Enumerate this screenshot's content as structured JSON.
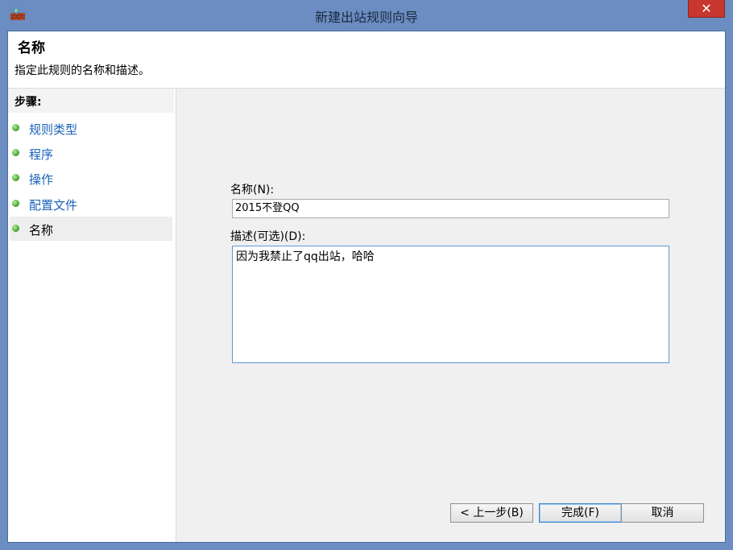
{
  "window": {
    "title": "新建出站规则向导",
    "close_label": "✕"
  },
  "header": {
    "title": "名称",
    "description": "指定此规则的名称和描述。"
  },
  "sidebar": {
    "title": "步骤:",
    "steps": [
      {
        "label": "规则类型"
      },
      {
        "label": "程序"
      },
      {
        "label": "操作"
      },
      {
        "label": "配置文件"
      },
      {
        "label": "名称"
      }
    ]
  },
  "form": {
    "name_label": "名称(N):",
    "name_value": "2015不登QQ",
    "desc_label": "描述(可选)(D):",
    "desc_value": "因为我禁止了qq出站，哈哈"
  },
  "buttons": {
    "back": "< 上一步(B)",
    "finish": "完成(F)",
    "cancel": "取消"
  },
  "icons": {
    "app": "firewall-icon",
    "step_dot": "green-dot-icon"
  },
  "colors": {
    "titlebar": "#6b8dc1",
    "close": "#c7372f",
    "link": "#1a62b8"
  }
}
